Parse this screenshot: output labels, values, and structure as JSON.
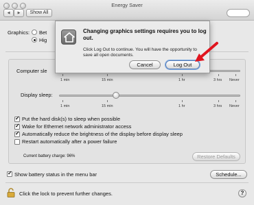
{
  "window": {
    "title": "Energy Saver"
  },
  "toolbar": {
    "show_all_label": "Show All",
    "back_glyph": "◀",
    "forward_glyph": "▶"
  },
  "graphics": {
    "label": "Graphics:",
    "options": [
      "Bet",
      "Hig"
    ],
    "selected_index": 1
  },
  "computer_sleep": {
    "label": "Computer sle"
  },
  "display_sleep": {
    "label": "Display sleep:",
    "value_minutes": 15
  },
  "slider_ticks": [
    "1 min",
    "15 min",
    "1 hr",
    "3 hrs",
    "Never"
  ],
  "options": [
    {
      "label": "Put the hard disk(s) to sleep when possible",
      "checked": true
    },
    {
      "label": "Wake for Ethernet network administrator access",
      "checked": true
    },
    {
      "label": "Automatically reduce the brightness of the display before display sleep",
      "checked": true
    },
    {
      "label": "Restart automatically after a power failure",
      "checked": false
    }
  ],
  "battery": {
    "charge_text": "Current battery charge: 96%"
  },
  "buttons": {
    "restore_defaults": "Restore Defaults",
    "schedule": "Schedule...",
    "help": "?"
  },
  "menu_bar": {
    "label": "Show battery status in the menu bar",
    "checked": true
  },
  "lock": {
    "label": "Click the lock to prevent further changes."
  },
  "dialog": {
    "title": "Changing graphics settings requires you to log out.",
    "body": "Click Log Out to continue. You will have the opportunity to save all open documents.",
    "cancel_label": "Cancel",
    "logout_label": "Log Out"
  },
  "colors": {
    "arrow": "#e0141e",
    "focus_ring": "#7aa7e0"
  }
}
